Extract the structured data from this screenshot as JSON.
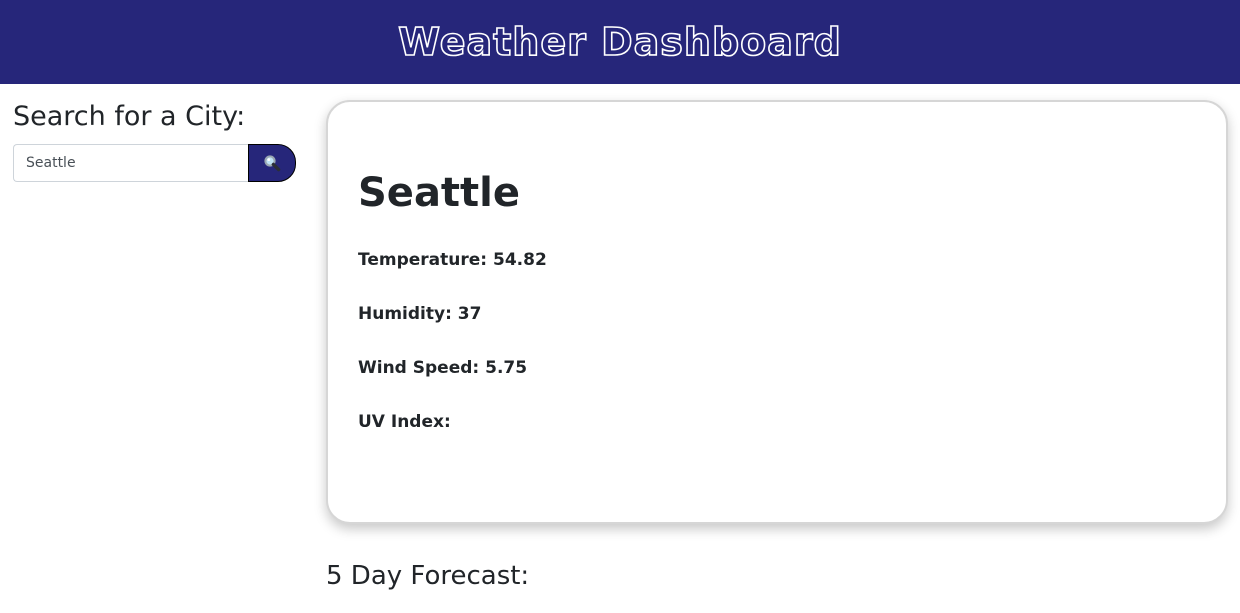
{
  "header": {
    "title": "Weather Dashboard"
  },
  "sidebar": {
    "heading": "Search for a City:",
    "search": {
      "value": "Seattle",
      "button_icon": "magnifier-icon"
    }
  },
  "current": {
    "city": "Seattle",
    "temperature": "Temperature: 54.82",
    "humidity": "Humidity: 37",
    "wind_speed": "Wind Speed: 5.75",
    "uv_index": "UV Index:"
  },
  "forecast": {
    "title": "5 Day Forecast:"
  },
  "colors": {
    "brand": "#26267a",
    "text": "#212529",
    "card_border": "#d6d6d6"
  }
}
